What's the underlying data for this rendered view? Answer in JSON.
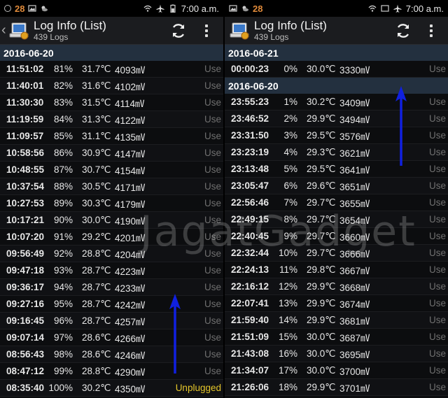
{
  "status": {
    "notif_count": "28",
    "time": "7:00 a.m."
  },
  "left": {
    "title": "Log Info (List)",
    "subtitle": "439 Logs",
    "sections": [
      {
        "date": "2016-06-20",
        "rows": [
          [
            "11:51:02",
            "81%",
            "31.7℃",
            "4093㎷",
            "Use"
          ],
          [
            "11:40:01",
            "82%",
            "31.6℃",
            "4102㎷",
            "Use"
          ],
          [
            "11:30:30",
            "83%",
            "31.5℃",
            "4114㎷",
            "Use"
          ],
          [
            "11:19:59",
            "84%",
            "31.3℃",
            "4122㎷",
            "Use"
          ],
          [
            "11:09:57",
            "85%",
            "31.1℃",
            "4135㎷",
            "Use"
          ],
          [
            "10:58:56",
            "86%",
            "30.9℃",
            "4147㎷",
            "Use"
          ],
          [
            "10:48:55",
            "87%",
            "30.7℃",
            "4154㎷",
            "Use"
          ],
          [
            "10:37:54",
            "88%",
            "30.5℃",
            "4171㎷",
            "Use"
          ],
          [
            "10:27:53",
            "89%",
            "30.3℃",
            "4179㎷",
            "Use"
          ],
          [
            "10:17:21",
            "90%",
            "30.0℃",
            "4190㎷",
            "Use"
          ],
          [
            "10:07:20",
            "91%",
            "29.2℃",
            "4201㎷",
            "Use"
          ],
          [
            "09:56:49",
            "92%",
            "28.8℃",
            "4204㎷",
            "Use"
          ],
          [
            "09:47:18",
            "93%",
            "28.7℃",
            "4223㎷",
            "Use"
          ],
          [
            "09:36:17",
            "94%",
            "28.7℃",
            "4233㎷",
            "Use"
          ],
          [
            "09:27:16",
            "95%",
            "28.7℃",
            "4242㎷",
            "Use"
          ],
          [
            "09:16:45",
            "96%",
            "28.7℃",
            "4257㎷",
            "Use"
          ],
          [
            "09:07:14",
            "97%",
            "28.6℃",
            "4266㎷",
            "Use"
          ],
          [
            "08:56:43",
            "98%",
            "28.6℃",
            "4246㎷",
            "Use"
          ],
          [
            "08:47:12",
            "99%",
            "28.8℃",
            "4290㎷",
            "Use"
          ],
          [
            "08:35:40",
            "100%",
            "30.2℃",
            "4350㎷",
            "Unplugged"
          ]
        ]
      }
    ]
  },
  "right": {
    "title": "Log Info (List)",
    "subtitle": "439 Logs",
    "sections": [
      {
        "date": "2016-06-21",
        "rows": [
          [
            "00:00:23",
            "0%",
            "30.0℃",
            "3330㎷",
            "Use"
          ]
        ]
      },
      {
        "date": "2016-06-20",
        "rows": [
          [
            "23:55:23",
            "1%",
            "30.2℃",
            "3409㎷",
            "Use"
          ],
          [
            "23:46:52",
            "2%",
            "29.9℃",
            "3494㎷",
            "Use"
          ],
          [
            "23:31:50",
            "3%",
            "29.5℃",
            "3576㎷",
            "Use"
          ],
          [
            "23:23:19",
            "4%",
            "29.3℃",
            "3621㎷",
            "Use"
          ],
          [
            "23:13:48",
            "5%",
            "29.5℃",
            "3641㎷",
            "Use"
          ],
          [
            "23:05:47",
            "6%",
            "29.6℃",
            "3651㎷",
            "Use"
          ],
          [
            "22:56:46",
            "7%",
            "29.7℃",
            "3655㎷",
            "Use"
          ],
          [
            "22:49:15",
            "8%",
            "29.7℃",
            "3654㎷",
            "Use"
          ],
          [
            "22:40:45",
            "9%",
            "29.7℃",
            "3660㎷",
            "Use"
          ],
          [
            "22:32:44",
            "10%",
            "29.7℃",
            "3666㎷",
            "Use"
          ],
          [
            "22:24:13",
            "11%",
            "29.8℃",
            "3667㎷",
            "Use"
          ],
          [
            "22:16:12",
            "12%",
            "29.9℃",
            "3668㎷",
            "Use"
          ],
          [
            "22:07:41",
            "13%",
            "29.9℃",
            "3674㎷",
            "Use"
          ],
          [
            "21:59:40",
            "14%",
            "29.9℃",
            "3681㎷",
            "Use"
          ],
          [
            "21:51:09",
            "15%",
            "30.0℃",
            "3687㎷",
            "Use"
          ],
          [
            "21:43:08",
            "16%",
            "30.0℃",
            "3695㎷",
            "Use"
          ],
          [
            "21:34:07",
            "17%",
            "30.0℃",
            "3700㎷",
            "Use"
          ],
          [
            "21:26:06",
            "18%",
            "29.9℃",
            "3701㎷",
            "Use"
          ]
        ]
      }
    ]
  },
  "watermark": "JagatGadget",
  "colors": {
    "header_bg": "#23303f",
    "unplugged": "#e5c62a",
    "use": "#6f6f6f",
    "arrow": "#1020e0"
  }
}
